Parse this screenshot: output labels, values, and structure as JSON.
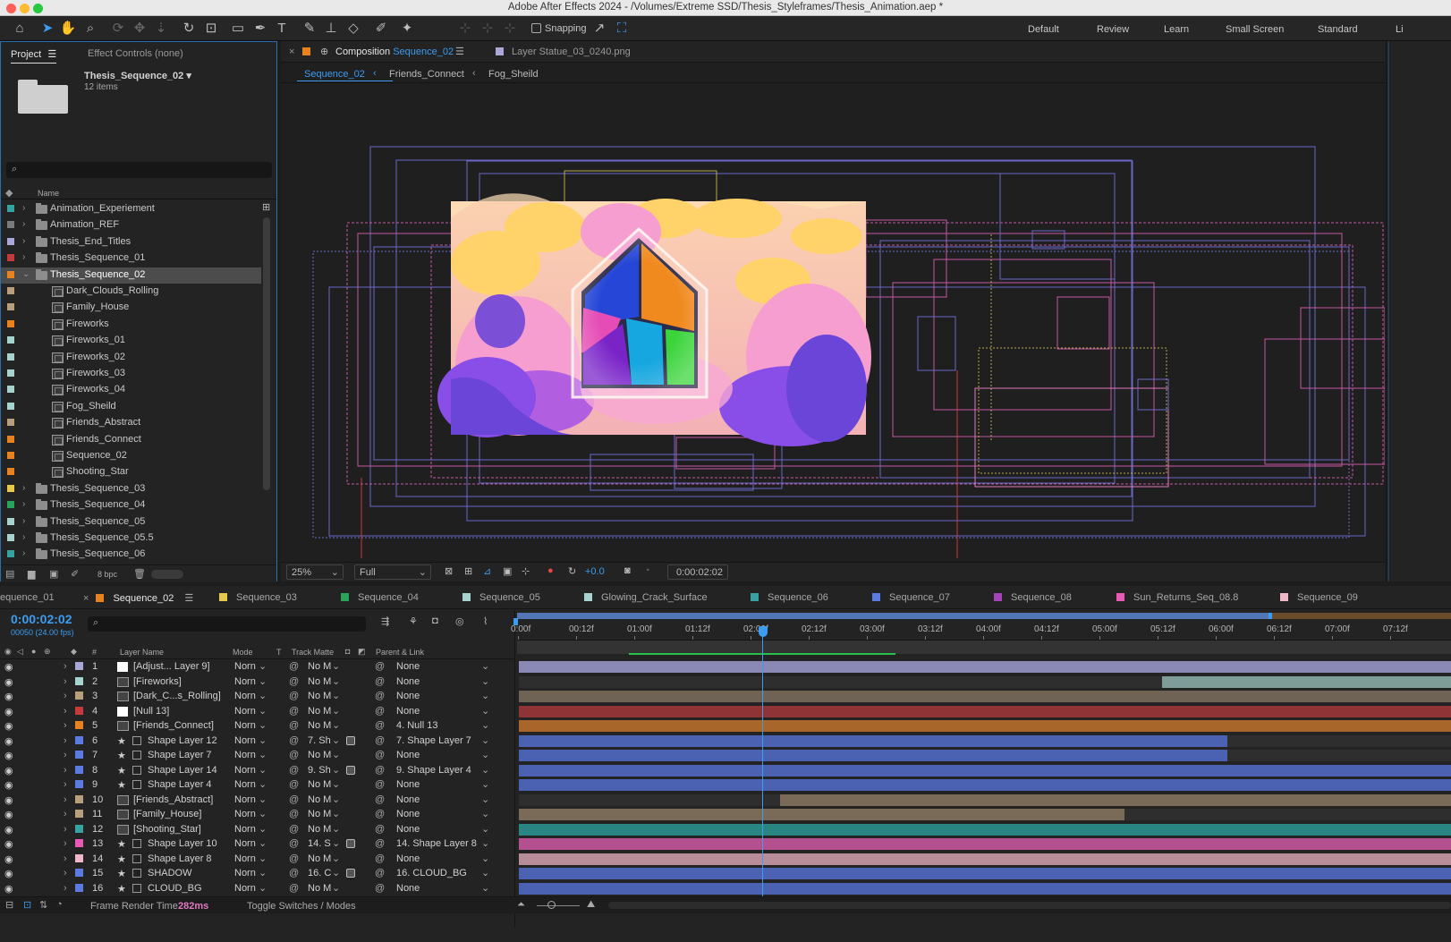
{
  "window": {
    "title": "Adobe After Effects 2024 - /Volumes/Extreme SSD/Thesis_Styleframes/Thesis_Animation.aep *"
  },
  "toolbar": {
    "snapping": "Snapping",
    "workspaces": [
      "Default",
      "Review",
      "Learn",
      "Small Screen",
      "Standard",
      "Li"
    ]
  },
  "project": {
    "tab": "Project",
    "tab_effect": "Effect Controls (none)",
    "selected_name": "Thesis_Sequence_02 ▾",
    "selected_count": "12 items",
    "col_name": "Name",
    "bpc": "8 bpc",
    "items": [
      {
        "name": "Animation_Experiement",
        "type": "folder",
        "color": "#36a3a0"
      },
      {
        "name": "Animation_REF",
        "type": "folder",
        "color": "#7a7a7a"
      },
      {
        "name": "Thesis_End_Titles",
        "type": "folder",
        "color": "#a9a8d8"
      },
      {
        "name": "Thesis_Sequence_01",
        "type": "folder",
        "color": "#c8393b"
      },
      {
        "name": "Thesis_Sequence_02",
        "type": "folder",
        "color": "#e8821e",
        "open": true,
        "selected": true
      },
      {
        "name": "Dark_Clouds_Rolling",
        "type": "comp",
        "color": "#b89e7a"
      },
      {
        "name": "Family_House",
        "type": "comp",
        "color": "#b89e7a"
      },
      {
        "name": "Fireworks",
        "type": "comp",
        "color": "#e8821e"
      },
      {
        "name": "Fireworks_01",
        "type": "comp",
        "color": "#a7d3cf"
      },
      {
        "name": "Fireworks_02",
        "type": "comp",
        "color": "#a7d3cf"
      },
      {
        "name": "Fireworks_03",
        "type": "comp",
        "color": "#a7d3cf"
      },
      {
        "name": "Fireworks_04",
        "type": "comp",
        "color": "#a7d3cf"
      },
      {
        "name": "Fog_Sheild",
        "type": "comp",
        "color": "#a7d3cf"
      },
      {
        "name": "Friends_Abstract",
        "type": "comp",
        "color": "#b89e7a"
      },
      {
        "name": "Friends_Connect",
        "type": "comp",
        "color": "#e8821e"
      },
      {
        "name": "Sequence_02",
        "type": "comp",
        "color": "#e8821e"
      },
      {
        "name": "Shooting_Star",
        "type": "comp",
        "color": "#e8821e"
      },
      {
        "name": "Thesis_Sequence_03",
        "type": "folder",
        "color": "#e6c94a"
      },
      {
        "name": "Thesis_Sequence_04",
        "type": "folder",
        "color": "#29a35a"
      },
      {
        "name": "Thesis_Sequence_05",
        "type": "folder",
        "color": "#a7d3cf"
      },
      {
        "name": "Thesis_Sequence_05.5",
        "type": "folder",
        "color": "#a7d3cf"
      },
      {
        "name": "Thesis_Sequence_06",
        "type": "folder",
        "color": "#36a3a0"
      }
    ]
  },
  "composition": {
    "tab_prefix": "Composition",
    "tab_name": "Sequence_02",
    "layer_tab": "Layer Statue_03_0240.png",
    "breadcrumbs": [
      "Sequence_02",
      "Friends_Connect",
      "Fog_Sheild"
    ],
    "zoom": "25%",
    "quality": "Full",
    "exposure": "+0.0",
    "timecode": "0:00:02:02"
  },
  "timeline": {
    "tabs": [
      {
        "name": "equence_01",
        "color": null
      },
      {
        "name": "Sequence_02",
        "color": "#e8821e",
        "active": true
      },
      {
        "name": "Sequence_03",
        "color": "#e6c94a"
      },
      {
        "name": "Sequence_04",
        "color": "#29a35a"
      },
      {
        "name": "Sequence_05",
        "color": "#a7d3cf"
      },
      {
        "name": "Glowing_Crack_Surface",
        "color": "#a7d3cf"
      },
      {
        "name": "Sequence_06",
        "color": "#36a3a0"
      },
      {
        "name": "Sequence_07",
        "color": "#5b7be0"
      },
      {
        "name": "Sequence_08",
        "color": "#a544b8"
      },
      {
        "name": "Sun_Returns_Seq_08.8",
        "color": "#e85ab3"
      },
      {
        "name": "Sequence_09",
        "color": "#f0b7c8"
      }
    ],
    "current_time": "0:00:02:02",
    "frame_info": "00050 (24.00 fps)",
    "cols": {
      "num": "#",
      "layer_name": "Layer Name",
      "mode": "Mode",
      "t": "T",
      "track_matte": "Track Matte",
      "parent": "Parent & Link"
    },
    "ruler": [
      "0:00f",
      "00:12f",
      "01:00f",
      "01:12f",
      "02:00f",
      "02:12f",
      "03:00f",
      "03:12f",
      "04:00f",
      "04:12f",
      "05:00f",
      "05:12f",
      "06:00f",
      "06:12f",
      "07:00f",
      "07:12f"
    ],
    "render_label": "Frame Render Time",
    "render_time": "282ms",
    "toggle": "Toggle Switches / Modes",
    "layers": [
      {
        "n": "1",
        "name": "[Adjust... Layer 9]",
        "color": "#a9a8d8",
        "icon": "solid",
        "mode": "Norn",
        "matte": "No M",
        "parent": "None",
        "star": false,
        "bar": "#8a88b5",
        "bar_start": 0,
        "bar_end": 1
      },
      {
        "n": "2",
        "name": "[Fireworks]",
        "color": "#a7d3cf",
        "icon": "comp",
        "mode": "Norn",
        "matte": "No M",
        "parent": "None",
        "star": false,
        "bar": "#7e9c98",
        "bar_start": 0.69,
        "bar_end": 1
      },
      {
        "n": "3",
        "name": "[Dark_C...s_Rolling]",
        "color": "#b89e7a",
        "icon": "comp",
        "mode": "Norn",
        "matte": "No M",
        "parent": "None",
        "star": false,
        "bar": "#6f6355",
        "bar_start": 0,
        "bar_end": 1
      },
      {
        "n": "4",
        "name": "[Null 13]",
        "color": "#c8393b",
        "icon": "solid",
        "mode": "Norn",
        "matte": "No M",
        "parent": "None",
        "star": false,
        "bar": "#8e3436",
        "bar_start": 0,
        "bar_end": 1
      },
      {
        "n": "5",
        "name": "[Friends_Connect]",
        "color": "#e8821e",
        "icon": "comp",
        "mode": "Norn",
        "matte": "No M",
        "parent": "4. Null 13",
        "star": false,
        "bar": "#a9662a",
        "bar_start": 0,
        "bar_end": 1
      },
      {
        "n": "6",
        "name": "Shape Layer 12",
        "color": "#5b7be0",
        "icon": "shape",
        "mode": "Norn",
        "matte": "7. Sh",
        "parent": "7. Shape Layer 7",
        "star": true,
        "bar": "#4b62b3",
        "bar_start": 0,
        "bar_end": 0.76
      },
      {
        "n": "7",
        "name": "Shape Layer 7",
        "color": "#5b7be0",
        "icon": "shape",
        "mode": "Norn",
        "matte": "No M",
        "parent": "None",
        "star": true,
        "bar": "#4b62b3",
        "bar_start": 0,
        "bar_end": 0.76
      },
      {
        "n": "8",
        "name": "Shape Layer 14",
        "color": "#5b7be0",
        "icon": "shape",
        "mode": "Norn",
        "matte": "9. Sh",
        "parent": "9. Shape Layer 4",
        "star": true,
        "bar": "#4b62b3",
        "bar_start": 0,
        "bar_end": 1
      },
      {
        "n": "9",
        "name": "Shape Layer 4",
        "color": "#5b7be0",
        "icon": "shape",
        "mode": "Norn",
        "matte": "No M",
        "parent": "None",
        "star": true,
        "bar": "#4b62b3",
        "bar_start": 0,
        "bar_end": 1
      },
      {
        "n": "10",
        "name": "[Friends_Abstract]",
        "color": "#b89e7a",
        "icon": "comp",
        "mode": "Norn",
        "matte": "No M",
        "parent": "None",
        "star": false,
        "bar": "#7a6a58",
        "bar_start": 0.28,
        "bar_end": 1
      },
      {
        "n": "11",
        "name": "[Family_House]",
        "color": "#b89e7a",
        "icon": "comp",
        "mode": "Norn",
        "matte": "No M",
        "parent": "None",
        "star": false,
        "bar": "#7a6a58",
        "bar_start": 0,
        "bar_end": 0.65
      },
      {
        "n": "12",
        "name": "[Shooting_Star]",
        "color": "#36a3a0",
        "icon": "comp",
        "mode": "Norn",
        "matte": "No M",
        "parent": "None",
        "star": false,
        "bar": "#2a8683",
        "bar_start": 0,
        "bar_end": 1
      },
      {
        "n": "13",
        "name": "Shape Layer 10",
        "color": "#e85ab3",
        "icon": "shape",
        "mode": "Norn",
        "matte": "14. S",
        "parent": "14. Shape Layer 8",
        "star": true,
        "bar": "#b4508f",
        "bar_start": 0,
        "bar_end": 1
      },
      {
        "n": "14",
        "name": "Shape Layer 8",
        "color": "#f0b7c8",
        "icon": "shape",
        "mode": "Norn",
        "matte": "No M",
        "parent": "None",
        "star": true,
        "bar": "#b68d99",
        "bar_start": 0,
        "bar_end": 1
      },
      {
        "n": "15",
        "name": "SHADOW",
        "color": "#5b7be0",
        "icon": "shape",
        "mode": "Norn",
        "matte": "16. C",
        "parent": "16. CLOUD_BG",
        "star": true,
        "bar": "#4b62b3",
        "bar_start": 0,
        "bar_end": 1
      },
      {
        "n": "16",
        "name": "CLOUD_BG",
        "color": "#5b7be0",
        "icon": "shape",
        "mode": "Norn",
        "matte": "No M",
        "parent": "None",
        "star": true,
        "bar": "#4b62b3",
        "bar_start": 0,
        "bar_end": 1
      }
    ]
  }
}
